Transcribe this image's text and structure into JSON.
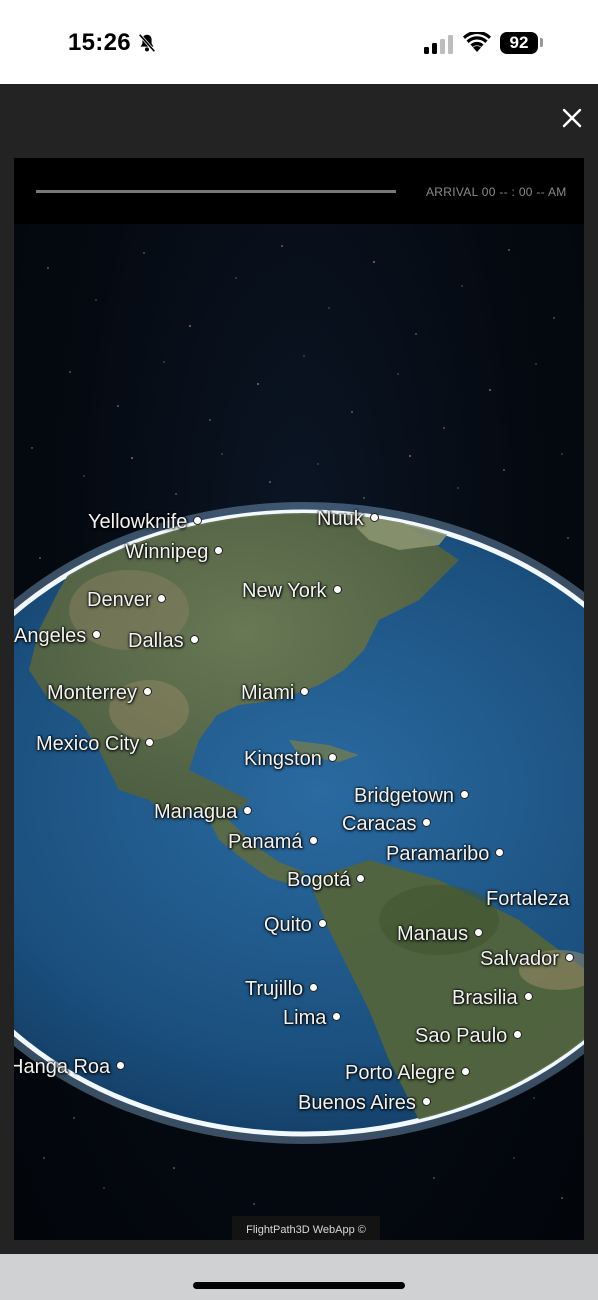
{
  "status_bar": {
    "time": "15:26",
    "battery": "92",
    "icons": [
      "bell-slash-icon",
      "cellular-signal-icon",
      "wifi-icon",
      "battery-icon"
    ]
  },
  "modal": {
    "close_icon": "close-icon"
  },
  "flight_bar": {
    "arrival": "ARRIVAL 00 -- : 00 -- AM",
    "progress": 1.0
  },
  "map": {
    "cities": [
      {
        "name": "Yellowknife"
      },
      {
        "name": "Nuuk"
      },
      {
        "name": "Winnipeg"
      },
      {
        "name": "New York"
      },
      {
        "name": "Denver"
      },
      {
        "name": "Angeles"
      },
      {
        "name": "Dallas"
      },
      {
        "name": "Monterrey"
      },
      {
        "name": "Miami"
      },
      {
        "name": "Mexico City"
      },
      {
        "name": "Kingston"
      },
      {
        "name": "Bridgetown"
      },
      {
        "name": "Managua"
      },
      {
        "name": "Caracas"
      },
      {
        "name": "Panamá"
      },
      {
        "name": "Paramaribo"
      },
      {
        "name": "Bogotá"
      },
      {
        "name": "Fortaleza"
      },
      {
        "name": "Quito"
      },
      {
        "name": "Manaus"
      },
      {
        "name": "Salvador"
      },
      {
        "name": "Trujillo"
      },
      {
        "name": "Brasilia"
      },
      {
        "name": "Lima"
      },
      {
        "name": "Sao Paulo"
      },
      {
        "name": "Hanga Roa"
      },
      {
        "name": "Porto Alegre"
      },
      {
        "name": "Buenos Aires"
      }
    ]
  },
  "credit": "FlightPath3D WebApp ©",
  "colors": {
    "ocean": "#1f5a8c",
    "atmosphere": "#cfe6ff",
    "space": "#050a12"
  }
}
